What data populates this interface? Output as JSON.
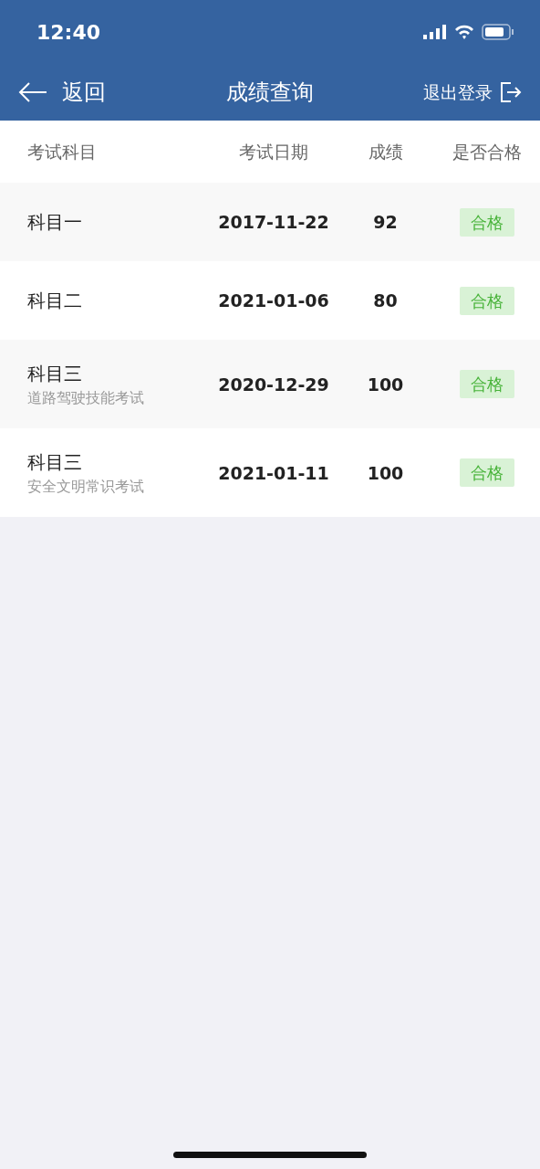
{
  "status_bar": {
    "time": "12:40"
  },
  "nav": {
    "back": "返回",
    "title": "成绩查询",
    "logout": "退出登录"
  },
  "table": {
    "columns": [
      "考试科目",
      "考试日期",
      "成绩",
      "是否合格"
    ],
    "rows": [
      {
        "subject": "科目一",
        "date": "2017-11-22",
        "score": "92",
        "result": "合格"
      },
      {
        "subject": "科目二",
        "date": "2021-01-06",
        "score": "80",
        "result": "合格"
      },
      {
        "subject": "科目三",
        "detail": "道路驾驶技能考试",
        "date": "2020-12-29",
        "score": "100",
        "result": "合格"
      },
      {
        "subject": "科目三",
        "detail": "安全文明常识考试",
        "date": "2021-01-11",
        "score": "100",
        "result": "合格"
      }
    ]
  }
}
